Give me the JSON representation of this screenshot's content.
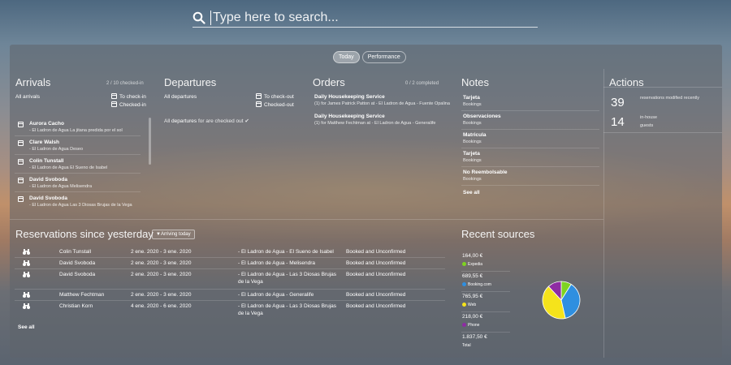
{
  "search": {
    "placeholder": "Type here to search..."
  },
  "tabs": [
    {
      "label": "Today",
      "active": true
    },
    {
      "label": "Performance",
      "active": false
    }
  ],
  "arrivals": {
    "title": "Arrivals",
    "count": "2 / 10 checked-in",
    "filter": "All arrivals",
    "to_checkin": "To check-in",
    "checked_in": "Checked-in",
    "items": [
      {
        "name": "Aurora Cacho",
        "desc": "- El Ladron de Agua La jitana predida por el sol"
      },
      {
        "name": "Clare Walsh",
        "desc": "- El Ladron de Agua Deseo"
      },
      {
        "name": "Colin Tunstall",
        "desc": "- El Ladron de Agua El Sueno de Isabel"
      },
      {
        "name": "David Svoboda",
        "desc": "- El Ladron de Agua Melisendra"
      },
      {
        "name": "David Svoboda",
        "desc": "- El Ladron de Agua Las 3 Diosas Brujas de la Vega"
      }
    ]
  },
  "departures": {
    "title": "Departures",
    "filter": "All departures",
    "to_checkout": "To check-out",
    "checked_out": "Checked-out",
    "status_prefix": "All",
    "status_bold": "departures",
    "status_rest": "for are checked out"
  },
  "orders": {
    "title": "Orders",
    "count": "0 / 2 completed",
    "items": [
      {
        "title": "Daily Housekeeping Service",
        "desc": "(1) for James Patrick Patton at - El Ladron de Agua - Fuente Opalina"
      },
      {
        "title": "Daily Housekeeping Service",
        "desc": "(1) for Matthew Fechtman at - El Ladron de Agua - Generalife"
      }
    ]
  },
  "notes": {
    "title": "Notes",
    "items": [
      {
        "title": "Tarjeta",
        "sub": "Bookings"
      },
      {
        "title": "Observaciones",
        "sub": "Bookings"
      },
      {
        "title": "Matricula",
        "sub": "Bookings"
      },
      {
        "title": "Tarjeta",
        "sub": "Bookings"
      },
      {
        "title": "No Reembolsable",
        "sub": "Bookings"
      }
    ],
    "see_all": "See all"
  },
  "actions": {
    "title": "Actions",
    "items": [
      {
        "value": "39",
        "label1": "reservations modified recently",
        "label2": ""
      },
      {
        "value": "14",
        "label1": "in-house",
        "label2": "guests"
      }
    ]
  },
  "reservations": {
    "title": "Reservations since yesterday",
    "filter": "Arriving today",
    "rows": [
      {
        "name": "Colin Tunstall",
        "dates": "2 ene. 2020 - 3 ene. 2020",
        "room": "- El Ladron de Agua - El Sueno de Isabel",
        "room2": "",
        "status": "Booked and Unconfirmed"
      },
      {
        "name": "David Svoboda",
        "dates": "2 ene. 2020 - 3 ene. 2020",
        "room": "- El Ladron de Agua - Melisendra",
        "room2": "",
        "status": "Booked and Unconfirmed"
      },
      {
        "name": "David Svoboda",
        "dates": "2 ene. 2020 - 3 ene. 2020",
        "room": "- El Ladron de Agua - Las 3 Diosas Brujas",
        "room2": "de la Vega",
        "status": "Booked and Unconfirmed"
      },
      {
        "name": "Matthew Fechtman",
        "dates": "2 ene. 2020 - 3 ene. 2020",
        "room": "- El Ladron de Agua - Generalife",
        "room2": "",
        "status": "Booked and Unconfirmed"
      },
      {
        "name": "Christian Korn",
        "dates": "4 ene. 2020 - 6 ene. 2020",
        "room": "- El Ladron de Agua - Las 3 Diosas Brujas",
        "room2": "de la Vega",
        "status": "Booked and Unconfirmed"
      }
    ],
    "see_all": "See all"
  },
  "sources": {
    "title": "Recent sources",
    "items": [
      {
        "value": "164,00 €",
        "label": "Expedia",
        "color": "#7ed321"
      },
      {
        "value": "689,55 €",
        "label": "Booking.com",
        "color": "#2f8fe0"
      },
      {
        "value": "765,95 €",
        "label": "Web",
        "color": "#f5e31b"
      },
      {
        "value": "218,00 €",
        "label": "Phone",
        "color": "#8e2ca3"
      },
      {
        "value": "1.837,50 €",
        "label": "Total",
        "color": ""
      }
    ]
  },
  "chart_data": {
    "type": "pie",
    "categories": [
      "Expedia",
      "Booking.com",
      "Web",
      "Phone"
    ],
    "values": [
      164.0,
      689.55,
      765.95,
      218.0
    ],
    "colors": [
      "#7ed321",
      "#2f8fe0",
      "#f5e31b",
      "#8e2ca3"
    ],
    "title": ""
  }
}
